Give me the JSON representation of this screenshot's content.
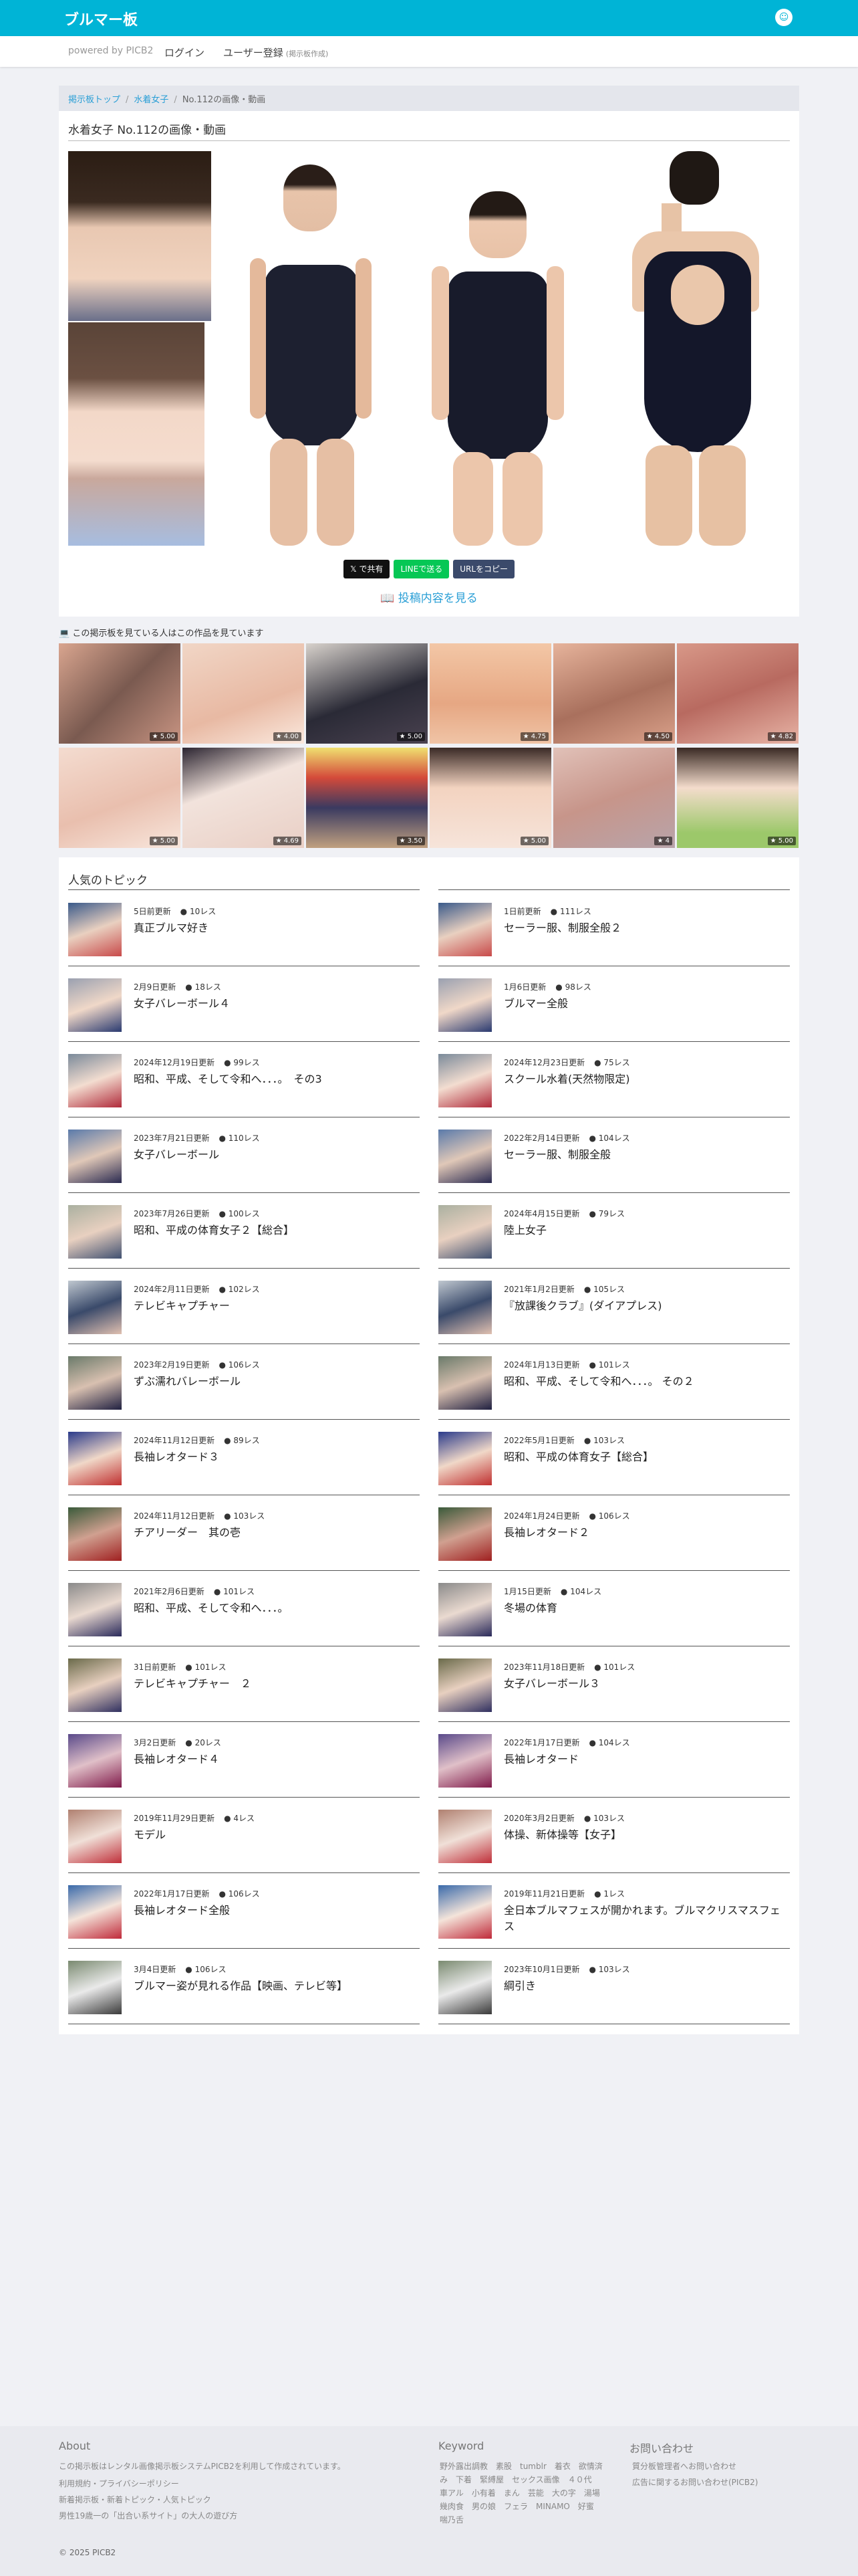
{
  "header": {
    "brand": "ブルマー板",
    "user_icon": "user-circle-icon",
    "accent": "#00b4d6"
  },
  "subnav": {
    "powered": "powered by PICB2",
    "login": "ログイン",
    "register": "ユーザー登録",
    "register_note": "(掲示板作成)"
  },
  "breadcrumb": {
    "home": "掲示板トップ",
    "category": "水着女子",
    "current": "No.112の画像・動画"
  },
  "post": {
    "title": "水着女子 No.112の画像・動画",
    "share_x": "𝕏 で共有",
    "share_line": "LINEで送る",
    "copy_url": "URLをコピー",
    "view_posts": "投稿内容を見る"
  },
  "watching": {
    "heading": "この掲示板を見ている人はこの作品を見ています",
    "ratings": [
      "5.00",
      "4.00",
      "5.00",
      "4.75",
      "4.50",
      "4.82",
      "5.00",
      "4.69",
      "3.50",
      "5.00",
      "4",
      "5.00"
    ]
  },
  "topics": {
    "heading": "人気のトピック",
    "left": [
      {
        "date": "5日前更新",
        "count": "10レス",
        "name": "真正ブルマ好き"
      },
      {
        "date": "2月9日更新",
        "count": "18レス",
        "name": "女子バレーボール４"
      },
      {
        "date": "2024年12月19日更新",
        "count": "99レス",
        "name": "昭和、平成、そして令和へ．．．。　その3"
      },
      {
        "date": "2023年7月21日更新",
        "count": "110レス",
        "name": "女子バレーボール"
      },
      {
        "date": "2023年7月26日更新",
        "count": "100レス",
        "name": "昭和、平成の体育女子２【総合】"
      },
      {
        "date": "2024年2月11日更新",
        "count": "102レス",
        "name": "テレビキャプチャー"
      },
      {
        "date": "2023年2月19日更新",
        "count": "106レス",
        "name": "ずぶ濡れバレーボール"
      },
      {
        "date": "2024年11月12日更新",
        "count": "89レス",
        "name": "長袖レオタード３"
      },
      {
        "date": "2024年11月12日更新",
        "count": "103レス",
        "name": "チアリーダー　其の壱"
      },
      {
        "date": "2021年2月6日更新",
        "count": "101レス",
        "name": "昭和、平成、そして令和へ．．．。"
      },
      {
        "date": "31日前更新",
        "count": "101レス",
        "name": "テレビキャプチャー　２"
      },
      {
        "date": "3月2日更新",
        "count": "20レス",
        "name": "長袖レオタード４"
      },
      {
        "date": "2019年11月29日更新",
        "count": "4レス",
        "name": "モデル"
      },
      {
        "date": "2022年1月17日更新",
        "count": "106レス",
        "name": "長袖レオタード全般"
      },
      {
        "date": "3月4日更新",
        "count": "106レス",
        "name": "ブルマー姿が見れる作品【映画、テレビ等】"
      }
    ],
    "right": [
      {
        "date": "1日前更新",
        "count": "111レス",
        "name": "セーラー服、制服全般２"
      },
      {
        "date": "1月6日更新",
        "count": "98レス",
        "name": "ブルマー全般"
      },
      {
        "date": "2024年12月23日更新",
        "count": "75レス",
        "name": "スクール水着(天然物限定)"
      },
      {
        "date": "2022年2月14日更新",
        "count": "104レス",
        "name": "セーラー服、制服全般"
      },
      {
        "date": "2024年4月15日更新",
        "count": "79レス",
        "name": "陸上女子"
      },
      {
        "date": "2021年1月2日更新",
        "count": "105レス",
        "name": "『放課後クラブ』(ダイアプレス)"
      },
      {
        "date": "2024年1月13日更新",
        "count": "101レス",
        "name": "昭和、平成、そして令和へ．．．。 その２"
      },
      {
        "date": "2022年5月1日更新",
        "count": "103レス",
        "name": "昭和、平成の体育女子【総合】"
      },
      {
        "date": "2024年1月24日更新",
        "count": "106レス",
        "name": "長袖レオタード２"
      },
      {
        "date": "1月15日更新",
        "count": "104レス",
        "name": "冬場の体育"
      },
      {
        "date": "2023年11月18日更新",
        "count": "101レス",
        "name": "女子バレーボール３"
      },
      {
        "date": "2022年1月17日更新",
        "count": "104レス",
        "name": "長袖レオタード"
      },
      {
        "date": "2020年3月2日更新",
        "count": "103レス",
        "name": "体操、新体操等【女子】"
      },
      {
        "date": "2019年11月21日更新",
        "count": "1レス",
        "name": "全日本ブルマフェスが開かれます。ブルマクリスマスフェス"
      },
      {
        "date": "2023年10月1日更新",
        "count": "103レス",
        "name": "綱引き"
      }
    ]
  },
  "footer": {
    "about_title": "About",
    "about_text": "この掲示板はレンタル画像掲示板システムPICB2を利用して作成されています。",
    "links": [
      "利用規約・プライバシーポリシー",
      "新着掲示板・新着トピック・人気トピック",
      "男性19歳一の「出合い系サイト」の大人の遊び方"
    ],
    "keyword_title": "Keyword",
    "keywords": "野外露出調教　素股　tumblr　着衣　欲情済み　下着　緊縛屋　セックス画像　４０代　車アル　小有着　まん　芸能　大の字　湯場　幾肉食　男の娘　フェラ　MINAMO　好蜜　喘乃舌",
    "contact_title": "お問い合わせ",
    "contact_links": [
      "質分板管理者へお問い合わせ",
      "広告に関するお問い合わせ(PICB2)"
    ],
    "copyright": "© 2025 PICB2"
  }
}
